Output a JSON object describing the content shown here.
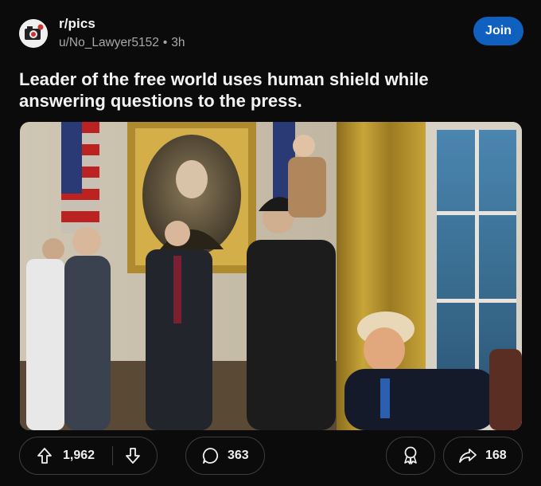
{
  "post": {
    "subreddit": "r/pics",
    "author": "u/No_Lawyer5152",
    "separator": "•",
    "age": "3h",
    "join_label": "Join",
    "title": "Leader of the free world uses human shield while answering questions to the press."
  },
  "media": {
    "type": "photo"
  },
  "actions": {
    "upvotes": "1,962",
    "comments": "363",
    "shares": "168"
  },
  "colors": {
    "background": "#0b0b0b",
    "join_button": "#1060c0",
    "muted_text": "#a8a8a8",
    "border": "#3e3e3e"
  },
  "icons": [
    "subreddit-avatar-icon",
    "upvote-icon",
    "downvote-icon",
    "comment-icon",
    "award-icon",
    "share-icon"
  ]
}
